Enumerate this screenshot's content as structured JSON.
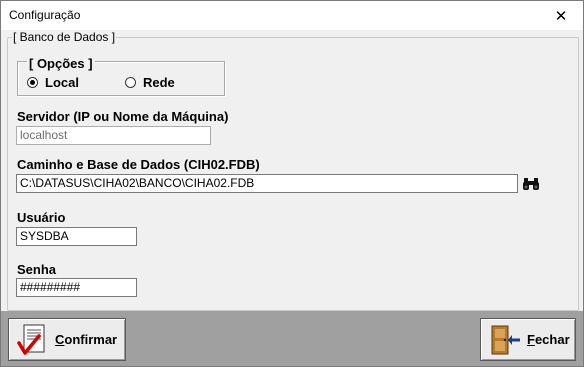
{
  "window": {
    "title": "Configuração",
    "close_glyph": "✕"
  },
  "group": {
    "label": "[ Banco de Dados ]"
  },
  "options": {
    "label": "[ Opções ]",
    "selected": "Local",
    "items": [
      {
        "label": "Local",
        "checked": true
      },
      {
        "label": "Rede",
        "checked": false
      }
    ]
  },
  "fields": {
    "servidor": {
      "label": "Servidor (IP ou Nome da Máquina)",
      "value": "localhost",
      "enabled": false
    },
    "caminho": {
      "label": "Caminho e Base de Dados (CIH02.FDB)",
      "value": "C:\\DATASUS\\CIHA02\\BANCO\\CIHA02.FDB"
    },
    "usuario": {
      "label": "Usuário",
      "value": "SYSDBA"
    },
    "senha": {
      "label": "Senha",
      "value": "#########"
    }
  },
  "buttons": {
    "confirmar": {
      "first": "C",
      "rest": "onfirmar"
    },
    "fechar": {
      "first": "F",
      "rest": "echar"
    }
  },
  "icons": {
    "browse": "binoculars-icon",
    "confirm": "document-check-icon",
    "close": "exit-door-icon"
  },
  "colors": {
    "footer": "#a0a0a0",
    "check_red": "#d40000"
  }
}
